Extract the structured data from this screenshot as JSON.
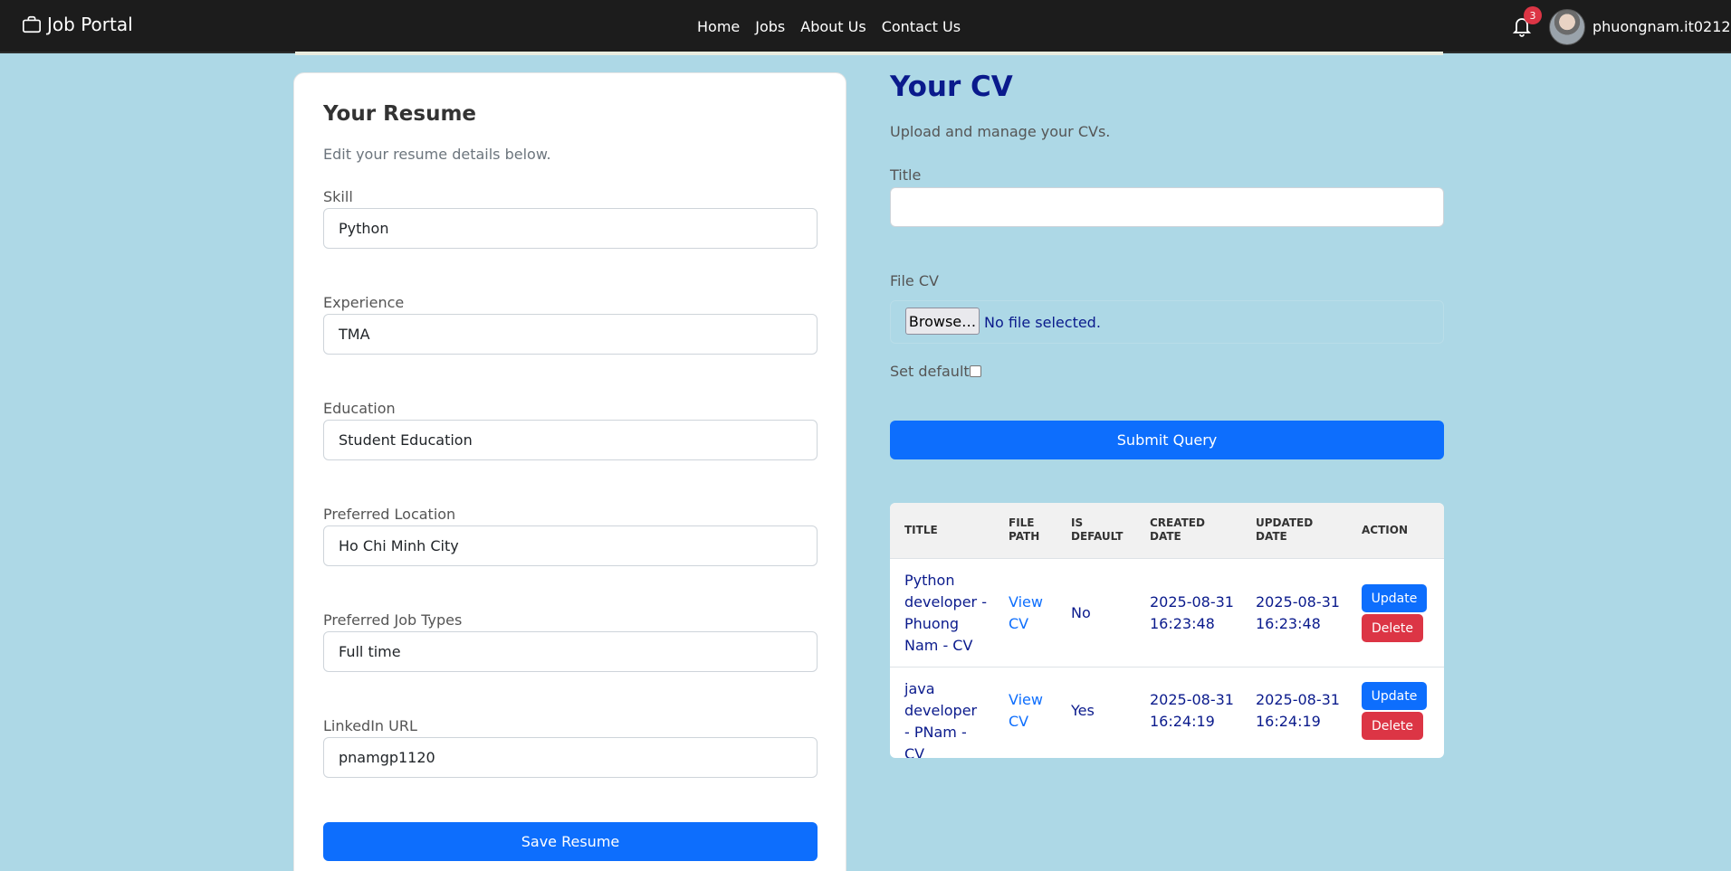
{
  "navbar": {
    "brand": "Job Portal",
    "links": [
      "Home",
      "Jobs",
      "About Us",
      "Contact Us"
    ],
    "notification_count": "3",
    "username": "phuongnam.it0212"
  },
  "resume": {
    "title": "Your Resume",
    "subtitle": "Edit your resume details below.",
    "fields": [
      {
        "label": "Skill",
        "value": "Python"
      },
      {
        "label": "Experience",
        "value": "TMA"
      },
      {
        "label": "Education",
        "value": "Student Education"
      },
      {
        "label": "Preferred Location",
        "value": "Ho Chi Minh City"
      },
      {
        "label": "Preferred Job Types",
        "value": "Full time"
      },
      {
        "label": "LinkedIn URL",
        "value": "pnamgp1120"
      }
    ],
    "save_label": "Save Resume"
  },
  "cv": {
    "title": "Your CV",
    "subtitle": "Upload and manage your CVs.",
    "title_label": "Title",
    "title_value": "",
    "file_label": "File CV",
    "browse_label": "Browse…",
    "no_file_text": "No file selected.",
    "default_label": "Set default",
    "submit_label": "Submit Query",
    "table": {
      "headers": [
        "TITLE",
        "FILE PATH",
        "IS DEFAULT",
        "CREATED DATE",
        "UPDATED DATE",
        "ACTION"
      ],
      "rows": [
        {
          "title": "Python developer - Phuong Nam - CV",
          "file_path": "View CV",
          "is_default": "No",
          "created": "2025-08-31 16:23:48",
          "updated": "2025-08-31 16:23:48",
          "update_label": "Update",
          "delete_label": "Delete"
        },
        {
          "title": "java developer - PNam - CV",
          "file_path": "View CV",
          "is_default": "Yes",
          "created": "2025-08-31 16:24:19",
          "updated": "2025-08-31 16:24:19",
          "update_label": "Update",
          "delete_label": "Delete"
        }
      ]
    }
  }
}
